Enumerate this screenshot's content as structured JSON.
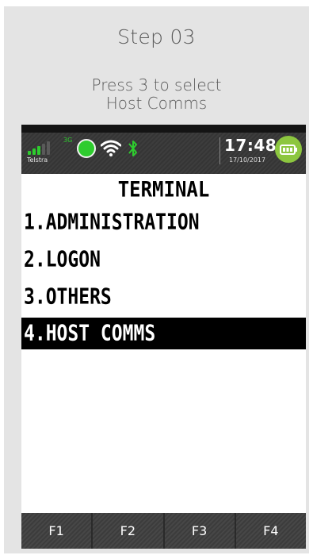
{
  "header": {
    "step_title": "Step 03",
    "instruction_line1": "Press 3 to select",
    "instruction_line2": "Host Comms"
  },
  "status_bar": {
    "network_type": "3G",
    "carrier": "Telstra",
    "time": "17:48",
    "date": "17/10/2017",
    "icons": [
      "signal-icon",
      "globe-icon",
      "wifi-icon",
      "bluetooth-icon",
      "battery-icon"
    ],
    "accent_color": "#2ecc2e"
  },
  "screen": {
    "title": "TERMINAL",
    "menu": [
      {
        "label": "1.ADMINISTRATION",
        "selected": false
      },
      {
        "label": "2.LOGON",
        "selected": false
      },
      {
        "label": "3.OTHERS",
        "selected": false
      },
      {
        "label": "4.HOST COMMS",
        "selected": true
      }
    ]
  },
  "function_keys": [
    "F1",
    "F2",
    "F3",
    "F4"
  ]
}
